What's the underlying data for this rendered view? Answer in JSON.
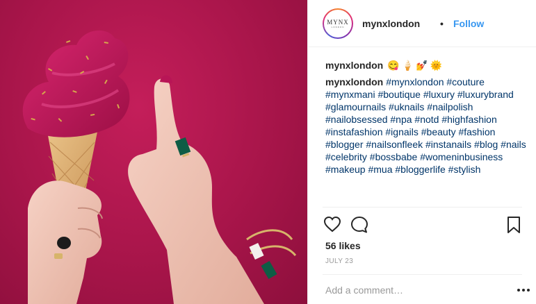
{
  "post": {
    "username": "mynxlondon",
    "follow_label": "Follow",
    "separator": "•",
    "avatar": {
      "logo_text": "MYNX",
      "logo_sub": "LONDON"
    },
    "caption": {
      "username": "mynxlondon",
      "emojis": [
        "😋",
        "🍦",
        "💅",
        "🌞"
      ],
      "hashtags_text": "#mynxlondon #couture #mynxmani #boutique #luxury #luxurybrand #glamournails #uknails #nailpolish #nailobsessed #npa #notd #highfashion #instafashion #ignails #beauty #fashion #blogger #nailsonfleek #instanails #blog #nails #celebrity #bossbabe #womeninbusiness #makeup #mua #bloggerlife #stylish"
    },
    "likes": "56 likes",
    "date": "JULY 23",
    "comment_placeholder": "Add a comment…",
    "icons": {
      "like": "heart-icon",
      "comment": "comment-bubble-icon",
      "save": "bookmark-icon",
      "more": "more-options-icon"
    },
    "colors": {
      "follow": "#3897f0",
      "hashtag": "#003569",
      "image_background": "#a8154a",
      "ice_cream": "#c0185a"
    }
  }
}
